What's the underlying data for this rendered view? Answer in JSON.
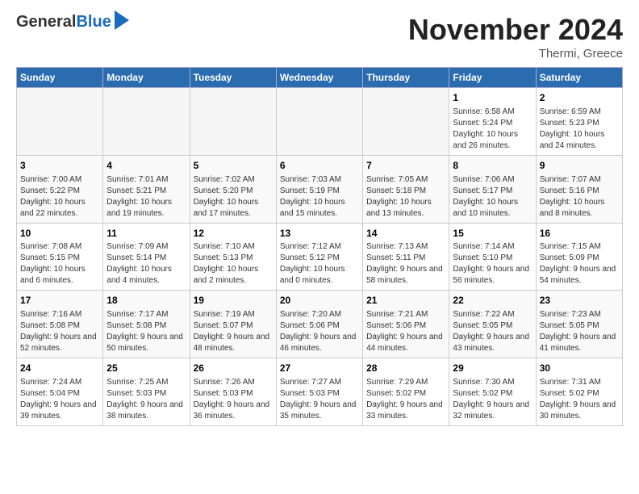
{
  "logo": {
    "general": "General",
    "blue": "Blue"
  },
  "title": "November 2024",
  "location": "Thermi, Greece",
  "days_header": [
    "Sunday",
    "Monday",
    "Tuesday",
    "Wednesday",
    "Thursday",
    "Friday",
    "Saturday"
  ],
  "weeks": [
    [
      {
        "num": "",
        "info": ""
      },
      {
        "num": "",
        "info": ""
      },
      {
        "num": "",
        "info": ""
      },
      {
        "num": "",
        "info": ""
      },
      {
        "num": "",
        "info": ""
      },
      {
        "num": "1",
        "info": "Sunrise: 6:58 AM\nSunset: 5:24 PM\nDaylight: 10 hours and 26 minutes."
      },
      {
        "num": "2",
        "info": "Sunrise: 6:59 AM\nSunset: 5:23 PM\nDaylight: 10 hours and 24 minutes."
      }
    ],
    [
      {
        "num": "3",
        "info": "Sunrise: 7:00 AM\nSunset: 5:22 PM\nDaylight: 10 hours and 22 minutes."
      },
      {
        "num": "4",
        "info": "Sunrise: 7:01 AM\nSunset: 5:21 PM\nDaylight: 10 hours and 19 minutes."
      },
      {
        "num": "5",
        "info": "Sunrise: 7:02 AM\nSunset: 5:20 PM\nDaylight: 10 hours and 17 minutes."
      },
      {
        "num": "6",
        "info": "Sunrise: 7:03 AM\nSunset: 5:19 PM\nDaylight: 10 hours and 15 minutes."
      },
      {
        "num": "7",
        "info": "Sunrise: 7:05 AM\nSunset: 5:18 PM\nDaylight: 10 hours and 13 minutes."
      },
      {
        "num": "8",
        "info": "Sunrise: 7:06 AM\nSunset: 5:17 PM\nDaylight: 10 hours and 10 minutes."
      },
      {
        "num": "9",
        "info": "Sunrise: 7:07 AM\nSunset: 5:16 PM\nDaylight: 10 hours and 8 minutes."
      }
    ],
    [
      {
        "num": "10",
        "info": "Sunrise: 7:08 AM\nSunset: 5:15 PM\nDaylight: 10 hours and 6 minutes."
      },
      {
        "num": "11",
        "info": "Sunrise: 7:09 AM\nSunset: 5:14 PM\nDaylight: 10 hours and 4 minutes."
      },
      {
        "num": "12",
        "info": "Sunrise: 7:10 AM\nSunset: 5:13 PM\nDaylight: 10 hours and 2 minutes."
      },
      {
        "num": "13",
        "info": "Sunrise: 7:12 AM\nSunset: 5:12 PM\nDaylight: 10 hours and 0 minutes."
      },
      {
        "num": "14",
        "info": "Sunrise: 7:13 AM\nSunset: 5:11 PM\nDaylight: 9 hours and 58 minutes."
      },
      {
        "num": "15",
        "info": "Sunrise: 7:14 AM\nSunset: 5:10 PM\nDaylight: 9 hours and 56 minutes."
      },
      {
        "num": "16",
        "info": "Sunrise: 7:15 AM\nSunset: 5:09 PM\nDaylight: 9 hours and 54 minutes."
      }
    ],
    [
      {
        "num": "17",
        "info": "Sunrise: 7:16 AM\nSunset: 5:08 PM\nDaylight: 9 hours and 52 minutes."
      },
      {
        "num": "18",
        "info": "Sunrise: 7:17 AM\nSunset: 5:08 PM\nDaylight: 9 hours and 50 minutes."
      },
      {
        "num": "19",
        "info": "Sunrise: 7:19 AM\nSunset: 5:07 PM\nDaylight: 9 hours and 48 minutes."
      },
      {
        "num": "20",
        "info": "Sunrise: 7:20 AM\nSunset: 5:06 PM\nDaylight: 9 hours and 46 minutes."
      },
      {
        "num": "21",
        "info": "Sunrise: 7:21 AM\nSunset: 5:06 PM\nDaylight: 9 hours and 44 minutes."
      },
      {
        "num": "22",
        "info": "Sunrise: 7:22 AM\nSunset: 5:05 PM\nDaylight: 9 hours and 43 minutes."
      },
      {
        "num": "23",
        "info": "Sunrise: 7:23 AM\nSunset: 5:05 PM\nDaylight: 9 hours and 41 minutes."
      }
    ],
    [
      {
        "num": "24",
        "info": "Sunrise: 7:24 AM\nSunset: 5:04 PM\nDaylight: 9 hours and 39 minutes."
      },
      {
        "num": "25",
        "info": "Sunrise: 7:25 AM\nSunset: 5:03 PM\nDaylight: 9 hours and 38 minutes."
      },
      {
        "num": "26",
        "info": "Sunrise: 7:26 AM\nSunset: 5:03 PM\nDaylight: 9 hours and 36 minutes."
      },
      {
        "num": "27",
        "info": "Sunrise: 7:27 AM\nSunset: 5:03 PM\nDaylight: 9 hours and 35 minutes."
      },
      {
        "num": "28",
        "info": "Sunrise: 7:29 AM\nSunset: 5:02 PM\nDaylight: 9 hours and 33 minutes."
      },
      {
        "num": "29",
        "info": "Sunrise: 7:30 AM\nSunset: 5:02 PM\nDaylight: 9 hours and 32 minutes."
      },
      {
        "num": "30",
        "info": "Sunrise: 7:31 AM\nSunset: 5:02 PM\nDaylight: 9 hours and 30 minutes."
      }
    ]
  ]
}
